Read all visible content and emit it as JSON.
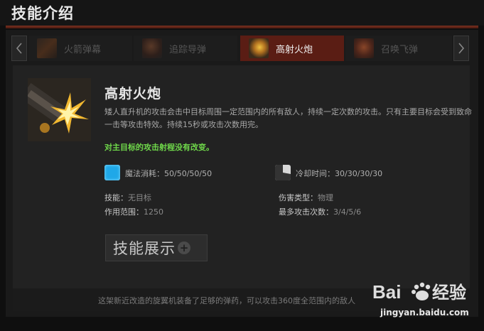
{
  "header": {
    "title": "技能介绍"
  },
  "tabs": [
    {
      "label": "火箭弹幕",
      "icon": "rocket-barrage-icon",
      "active": false
    },
    {
      "label": "追踪导弹",
      "icon": "homing-missile-icon",
      "active": false
    },
    {
      "label": "高射火炮",
      "icon": "flak-cannon-icon",
      "active": true
    },
    {
      "label": "召唤飞弹",
      "icon": "call-down-icon",
      "active": false
    }
  ],
  "skill": {
    "name": "高射火炮",
    "description": "矮人直升机的攻击会击中目标周围一定范围内的所有敌人，持续一定次数的攻击。只有主要目标会受到致命一击等攻击特效。持续15秒或攻击次数用完。",
    "note": "对主目标的攻击射程没有改变。",
    "mana_cost": "魔法消耗：50/50/50/50",
    "cooldown": "冷却时间：30/30/30/30",
    "ability_key": "技能：",
    "ability_value": "无目标",
    "damage_key": "伤害类型：",
    "damage_value": "物理",
    "range_key": "作用范围：",
    "range_value": "1250",
    "max_attacks_key": "最多攻击次数：",
    "max_attacks_value": "3/4/5/6"
  },
  "demo_button": {
    "label": "技能展示",
    "plus": "+"
  },
  "footer": {
    "text": "这架新近改造的旋翼机装备了足够的弹药，可以攻击360度全范围内的敌人"
  },
  "watermark": {
    "brand": "Bai du 经验",
    "url": "jingyan.baidu.com"
  },
  "colors": {
    "accent": "#5a1d14",
    "highlight": "#6fd84a",
    "mana": "#1fa8e8",
    "header_line": "#7a3020"
  }
}
